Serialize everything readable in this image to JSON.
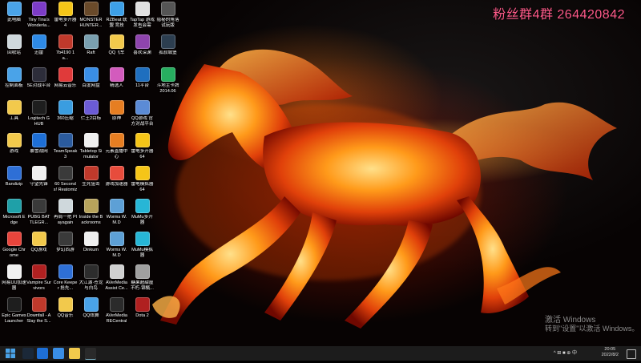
{
  "watermark": {
    "text": "粉丝群4群 264420842"
  },
  "activation": {
    "line1": "激活 Windows",
    "line2": "转到\"设置\"以激活 Windows。"
  },
  "desktop_icons": [
    {
      "label": "此电脑",
      "icon": "computer-icon",
      "color": "#4aa3e8"
    },
    {
      "label": "Tiny Tina's Wonderla...",
      "icon": "game-icon",
      "color": "#7d3cc7"
    },
    {
      "label": "雷电多开器4",
      "icon": "emulator-icon",
      "color": "#f5c518"
    },
    {
      "label": "MONSTER HUNTER...",
      "icon": "game-icon",
      "color": "#6a4a2a"
    },
    {
      "label": "RZBeat 联盟 竞技",
      "icon": "app-icon",
      "color": "#3da0e8"
    },
    {
      "label": "TapTap 游戏 发布会需要...",
      "icon": "document-icon",
      "color": "#e0e0e0"
    },
    {
      "label": "隐秘的角落 试玩版",
      "icon": "game-icon",
      "color": "#555555"
    },
    {
      "label": "回收站",
      "icon": "recycle-bin-icon",
      "color": "#cfd8dc"
    },
    {
      "label": "迅雷",
      "icon": "thunder-icon",
      "color": "#2e8ae6"
    },
    {
      "label": "7b4190 1a...",
      "icon": "game-icon",
      "color": "#c0392b"
    },
    {
      "label": "Raft",
      "icon": "raft-icon",
      "color": "#7aa0b0"
    },
    {
      "label": "QQ飞车",
      "icon": "qq-speed-icon",
      "color": "#f2c94c"
    },
    {
      "label": "喜欢深渊",
      "icon": "game-icon",
      "color": "#8e44ad"
    },
    {
      "label": "孤寂城堡",
      "icon": "game-icon",
      "color": "#2c3e50"
    },
    {
      "label": "控制面板",
      "icon": "control-panel-icon",
      "color": "#4aa3e8"
    },
    {
      "label": "5E对战平台",
      "icon": "5e-icon",
      "color": "#2d2d3a"
    },
    {
      "label": "网易云音乐",
      "icon": "netease-music-icon",
      "color": "#e03a3a"
    },
    {
      "label": "百度网盘",
      "icon": "baidu-netdisk-icon",
      "color": "#3a8ee6"
    },
    {
      "label": "精选人",
      "icon": "game-icon",
      "color": "#d35bbd"
    },
    {
      "label": "11平台",
      "icon": "game-icon",
      "color": "#1f6fbf"
    },
    {
      "label": "斗地主卡牌 2014.06",
      "icon": "app-icon",
      "color": "#27ae60"
    },
    {
      "label": "工具",
      "icon": "folder-icon",
      "color": "#f2c94c"
    },
    {
      "label": "Logitech G HUB",
      "icon": "logitech-icon",
      "color": "#1e1e1e"
    },
    {
      "label": "360压缩",
      "icon": "archive-icon",
      "color": "#3a9de0"
    },
    {
      "label": "仁王2目标",
      "icon": "game-icon",
      "color": "#6b5bd6"
    },
    {
      "label": "原神",
      "icon": "genshin-icon",
      "color": "#e67e22"
    },
    {
      "label": "QQ游戏 官方对战平台",
      "icon": "game-icon",
      "color": "#5b8bd6"
    },
    {
      "label": "游戏",
      "icon": "folder-icon",
      "color": "#f2c94c"
    },
    {
      "label": "暴雪战网",
      "icon": "battlenet-icon",
      "color": "#1e6fd6"
    },
    {
      "label": "TeamSpeak 3",
      "icon": "teamspeak-icon",
      "color": "#2b5b9e"
    },
    {
      "label": "Tabletop Simulator",
      "icon": "game-icon",
      "color": "#f0f0f0"
    },
    {
      "label": "元素直播中心",
      "icon": "app-icon",
      "color": "#e67e22"
    },
    {
      "label": "雷电多开器 64",
      "icon": "emulator-icon",
      "color": "#f5c518"
    },
    {
      "label": "Bandizip",
      "icon": "bandizip-icon",
      "color": "#2e6fd6"
    },
    {
      "label": "守望先锋",
      "icon": "overwatch-icon",
      "color": "#f0f0f0"
    },
    {
      "label": "60 Seconds! Reatomized",
      "icon": "game-icon",
      "color": "#3a3a3a"
    },
    {
      "label": "生死狙击",
      "icon": "game-icon",
      "color": "#c0392b"
    },
    {
      "label": "游戏加速器",
      "icon": "accelerator-icon",
      "color": "#e74c3c"
    },
    {
      "label": "雷电模拟器 64",
      "icon": "emulator-icon",
      "color": "#f5c518"
    },
    {
      "label": "Microsoft Edge",
      "icon": "edge-icon",
      "color": "#1fa0a8"
    },
    {
      "label": "PUBG BATTLEGR...",
      "icon": "pubg-icon",
      "color": "#3a3a3a"
    },
    {
      "label": "再局一把 Playagain",
      "icon": "app-icon",
      "color": "#cfd8dc"
    },
    {
      "label": "Inside the Backrooms",
      "icon": "game-icon",
      "color": "#b7a35b"
    },
    {
      "label": "Worms W.M.D",
      "icon": "game-icon",
      "color": "#5da0d6"
    },
    {
      "label": "MuMu多开器",
      "icon": "mumu-icon",
      "color": "#27b6d6"
    },
    {
      "label": "Google Chrome",
      "icon": "chrome-icon",
      "color": "#e8453c"
    },
    {
      "label": "QQ游戏",
      "icon": "qq-game-icon",
      "color": "#f2c94c"
    },
    {
      "label": "梦幻西游",
      "icon": "game-icon",
      "color": "#3a3a3a"
    },
    {
      "label": "Dinkum",
      "icon": "dinkum-icon",
      "color": "#f0f0f0"
    },
    {
      "label": "Worms W.M.D",
      "icon": "game-icon",
      "color": "#5da0d6"
    },
    {
      "label": "MuMu模拟器",
      "icon": "mumu-icon",
      "color": "#27b6d6"
    },
    {
      "label": "网易UU加速器",
      "icon": "document-icon",
      "color": "#f0f0f0"
    },
    {
      "label": "Vampire Survivors",
      "icon": "vampire-icon",
      "color": "#b02020"
    },
    {
      "label": "Core Keeper 抢先...",
      "icon": "game-icon",
      "color": "#2e6fd6"
    },
    {
      "label": "大江湖·苍龙 与白鸟",
      "icon": "game-icon",
      "color": "#2d2d2d"
    },
    {
      "label": "AVerMedia Assist Ce...",
      "icon": "avermedia-icon",
      "color": "#d0d0d0"
    },
    {
      "label": "糖果超甜屋 不朽·锦甄...",
      "icon": "game-icon",
      "color": "#a0a0a0"
    },
    {
      "label": "Epic Games Launcher",
      "icon": "epic-icon",
      "color": "#1e1e1e"
    },
    {
      "label": "Downfall - A Slay the S...",
      "icon": "game-icon",
      "color": "#c0392b"
    },
    {
      "label": "QQ音乐",
      "icon": "qq-music-icon",
      "color": "#f2c94c"
    },
    {
      "label": "QQ炫舞",
      "icon": "game-icon",
      "color": "#4aa3e8"
    },
    {
      "label": "AVerMedia RECentral",
      "icon": "avermedia-icon",
      "color": "#2b2b2b"
    },
    {
      "label": "Dota 2",
      "icon": "dota-icon",
      "color": "#b02020"
    }
  ],
  "taskbar": {
    "items": [
      {
        "name": "start-icon",
        "color": "#4aa3e8"
      },
      {
        "name": "steam-icon",
        "color": "#1b2838"
      },
      {
        "name": "battlenet-icon",
        "color": "#1e6fd6"
      },
      {
        "name": "browser-icon",
        "color": "#3a8ee6"
      },
      {
        "name": "file-explorer-icon",
        "color": "#f2c94c"
      },
      {
        "name": "obs-icon",
        "color": "#2a2a2a"
      }
    ],
    "tray_text": "^ ⊞ ■ ⊕ 中",
    "time": "20:05",
    "date": "2022/8/2"
  }
}
